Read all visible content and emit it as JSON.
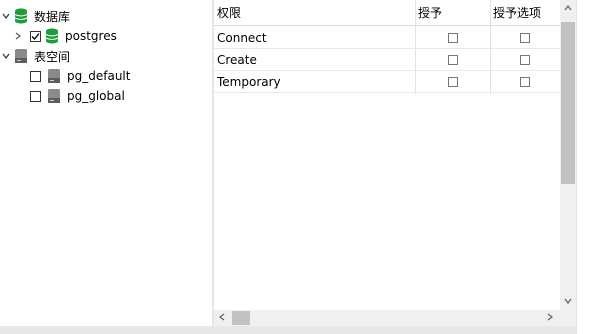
{
  "tree": {
    "databases_label": "数据库",
    "database_item": "postgres",
    "tablespaces_label": "表空间",
    "tablespace_items": [
      "pg_default",
      "pg_global"
    ]
  },
  "grid": {
    "headers": [
      "权限",
      "授予",
      "授予选项"
    ],
    "rows": [
      {
        "privilege": "Connect",
        "grant": false,
        "grant_option": false
      },
      {
        "privilege": "Create",
        "grant": false,
        "grant_option": false
      },
      {
        "privilege": "Temporary",
        "grant": false,
        "grant_option": false
      }
    ]
  },
  "colors": {
    "db_green": "#1e9c3a",
    "disk_gray": "#8a8a8a"
  }
}
